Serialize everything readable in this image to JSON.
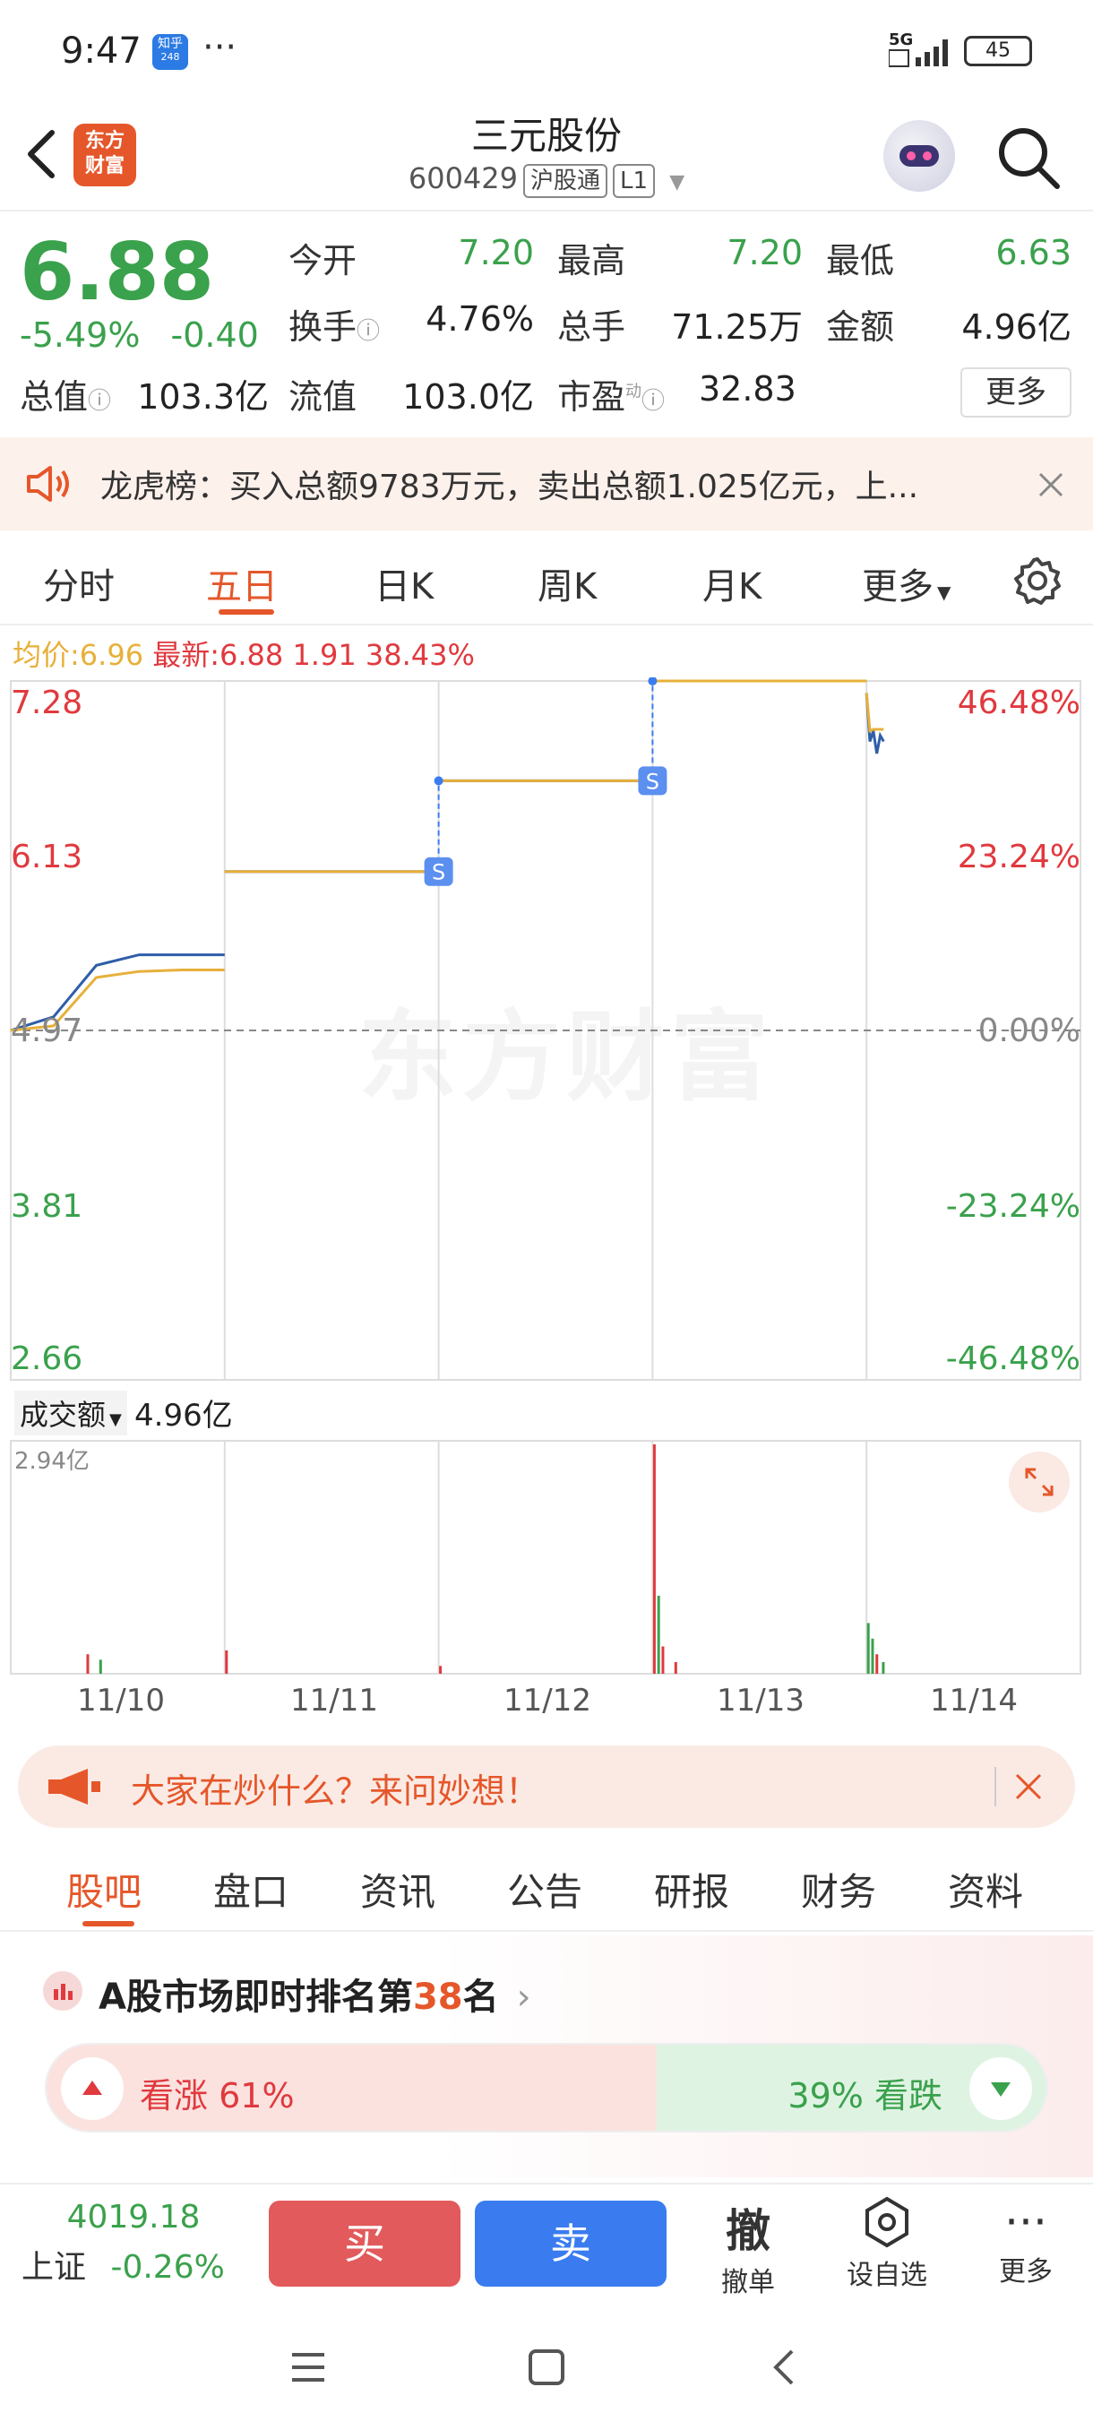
{
  "status_bar": {
    "time": "9:47",
    "zhihu_label": "知乎",
    "zhihu_sub": "248",
    "more": "···",
    "network": "5G",
    "battery": "45"
  },
  "header": {
    "logo_line1": "东方",
    "logo_line2": "财富",
    "stock_name": "三元股份",
    "stock_code": "600429",
    "tag_hgt": "沪股通",
    "tag_level": "L1"
  },
  "quote": {
    "price": "6.88",
    "change_pct": "-5.49%",
    "change_amt": "-0.40",
    "open_label": "今开",
    "open": "7.20",
    "high_label": "最高",
    "high": "7.20",
    "low_label": "最低",
    "low": "6.63",
    "turnover_label": "换手",
    "turnover": "4.76%",
    "volume_label": "总手",
    "volume": "71.25万",
    "amount_label": "金额",
    "amount": "4.96亿",
    "mktcap_label": "总值",
    "mktcap": "103.3亿",
    "float_label": "流值",
    "float": "103.0亿",
    "pe_label": "市盈",
    "pe_sup": "动",
    "pe": "32.83",
    "more_label": "更多"
  },
  "notice": {
    "text": "龙虎榜：买入总额9783万元，卖出总额1.025亿元，上..."
  },
  "chart_tabs": [
    "分时",
    "五日",
    "日K",
    "周K",
    "月K",
    "更多"
  ],
  "chart_tabs_active": "五日",
  "avg_row": {
    "avg_label": "均价:",
    "avg_value": "6.96",
    "latest_label": "最新:",
    "latest_value": "6.88",
    "vol_value": "1.91",
    "pct_value": "38.43%"
  },
  "chart_data": {
    "type": "line",
    "price_axis": [
      "7.28",
      "6.13",
      "4.97",
      "3.81",
      "2.66"
    ],
    "pct_axis": [
      "46.48%",
      "23.24%",
      "0.00%",
      "-23.24%",
      "-46.48%"
    ],
    "ylim": [
      2.66,
      7.28
    ],
    "baseline": 4.97,
    "days": [
      "11/10",
      "11/11",
      "11/12",
      "11/13",
      "11/14"
    ],
    "series": [
      {
        "color": "#2f5ea8",
        "values_by_day": [
          [
            4.97,
            5.06,
            5.4,
            5.47,
            5.47,
            5.47
          ],
          [
            6.02,
            6.02,
            6.02,
            6.02,
            6.02,
            6.02
          ],
          [
            6.62,
            6.62,
            6.62,
            6.62,
            6.62,
            6.62
          ],
          [
            7.28,
            7.28,
            7.28,
            7.28,
            7.28,
            7.28
          ],
          [
            7.2,
            6.88,
            6.95,
            6.8,
            6.92,
            6.88
          ]
        ]
      },
      {
        "color": "#e7b03a",
        "values_by_day": [
          [
            4.97,
            5.0,
            5.32,
            5.36,
            5.37,
            5.37
          ],
          [
            6.02,
            6.02,
            6.02,
            6.02,
            6.02,
            6.02
          ],
          [
            6.62,
            6.62,
            6.62,
            6.62,
            6.62,
            6.62
          ],
          [
            7.28,
            7.28,
            7.28,
            7.28,
            7.28,
            7.28
          ],
          [
            7.2,
            6.95,
            6.96,
            6.96,
            6.96,
            6.96
          ]
        ]
      }
    ],
    "markers": [
      "S",
      "S"
    ],
    "volume": {
      "label": "成交额",
      "total": "4.96亿",
      "max_label": "2.94亿",
      "max": 2.94,
      "spikes": [
        {
          "day": 0,
          "pos": 0.36,
          "value": 0.25,
          "color": "#e0393e"
        },
        {
          "day": 0,
          "pos": 0.42,
          "value": 0.18,
          "color": "#3aa14c"
        },
        {
          "day": 1,
          "pos": 0.0,
          "value": 0.3,
          "color": "#e0393e"
        },
        {
          "day": 2,
          "pos": 0.0,
          "value": 0.1,
          "color": "#e0393e"
        },
        {
          "day": 3,
          "pos": 0.0,
          "value": 2.94,
          "color": "#e0393e"
        },
        {
          "day": 3,
          "pos": 0.02,
          "value": 1.0,
          "color": "#3aa14c"
        },
        {
          "day": 3,
          "pos": 0.04,
          "value": 0.35,
          "color": "#e0393e"
        },
        {
          "day": 3,
          "pos": 0.1,
          "value": 0.15,
          "color": "#e0393e"
        },
        {
          "day": 4,
          "pos": 0.0,
          "value": 0.65,
          "color": "#3aa14c"
        },
        {
          "day": 4,
          "pos": 0.02,
          "value": 0.45,
          "color": "#3aa14c"
        },
        {
          "day": 4,
          "pos": 0.04,
          "value": 0.25,
          "color": "#e0393e"
        },
        {
          "day": 4,
          "pos": 0.07,
          "value": 0.15,
          "color": "#3aa14c"
        }
      ]
    }
  },
  "ad": {
    "text": "大家在炒什么？来问妙想！"
  },
  "section_tabs": [
    "股吧",
    "盘口",
    "资讯",
    "公告",
    "研报",
    "财务",
    "资料"
  ],
  "section_tabs_active": "股吧",
  "ranking": {
    "prefix": "A股市场即时排名第",
    "rank": "38",
    "suffix": "名",
    "up_label": "看涨",
    "up_pct": "61%",
    "down_label": "看跌",
    "down_pct": "39%",
    "up_fraction": 0.61
  },
  "tradebar": {
    "index_value": "4019.18",
    "index_name": "上证",
    "index_change": "-0.26%",
    "buy": "买",
    "sell": "卖",
    "cancel_icon": "撤",
    "cancel_label": "撤单",
    "watch_label": "设自选",
    "more_label": "更多"
  }
}
